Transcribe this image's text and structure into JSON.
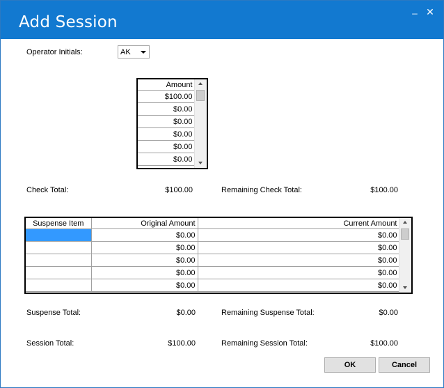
{
  "window": {
    "title": "Add Session",
    "minimize_label": "_",
    "close_label": "✕"
  },
  "operator": {
    "label": "Operator Initials:",
    "value": "AK"
  },
  "check_grid": {
    "header": "Amount",
    "rows": [
      "$100.00",
      "$0.00",
      "$0.00",
      "$0.00",
      "$0.00",
      "$0.00"
    ]
  },
  "check_total": {
    "label": "Check Total:",
    "value": "$100.00"
  },
  "remaining_check": {
    "label": "Remaining Check Total:",
    "value": "$100.00"
  },
  "suspense_grid": {
    "headers": [
      "Suspense Item",
      "Original Amount",
      "Current Amount"
    ],
    "rows": [
      [
        "",
        "$0.00",
        "$0.00"
      ],
      [
        "",
        "$0.00",
        "$0.00"
      ],
      [
        "",
        "$0.00",
        "$0.00"
      ],
      [
        "",
        "$0.00",
        "$0.00"
      ],
      [
        "",
        "$0.00",
        "$0.00"
      ]
    ]
  },
  "suspense_total": {
    "label": "Suspense Total:",
    "value": "$0.00"
  },
  "remaining_suspense": {
    "label": "Remaining Suspense Total:",
    "value": "$0.00"
  },
  "session_total": {
    "label": "Session Total:",
    "value": "$100.00"
  },
  "remaining_session": {
    "label": "Remaining Session Total:",
    "value": "$100.00"
  },
  "buttons": {
    "ok": "OK",
    "cancel": "Cancel"
  },
  "colors": {
    "titlebar": "#1279d0",
    "selection": "#3399ff"
  },
  "icons": {
    "minimize": "minimize-icon",
    "close": "close-icon",
    "dropdown": "chevron-down-icon"
  }
}
